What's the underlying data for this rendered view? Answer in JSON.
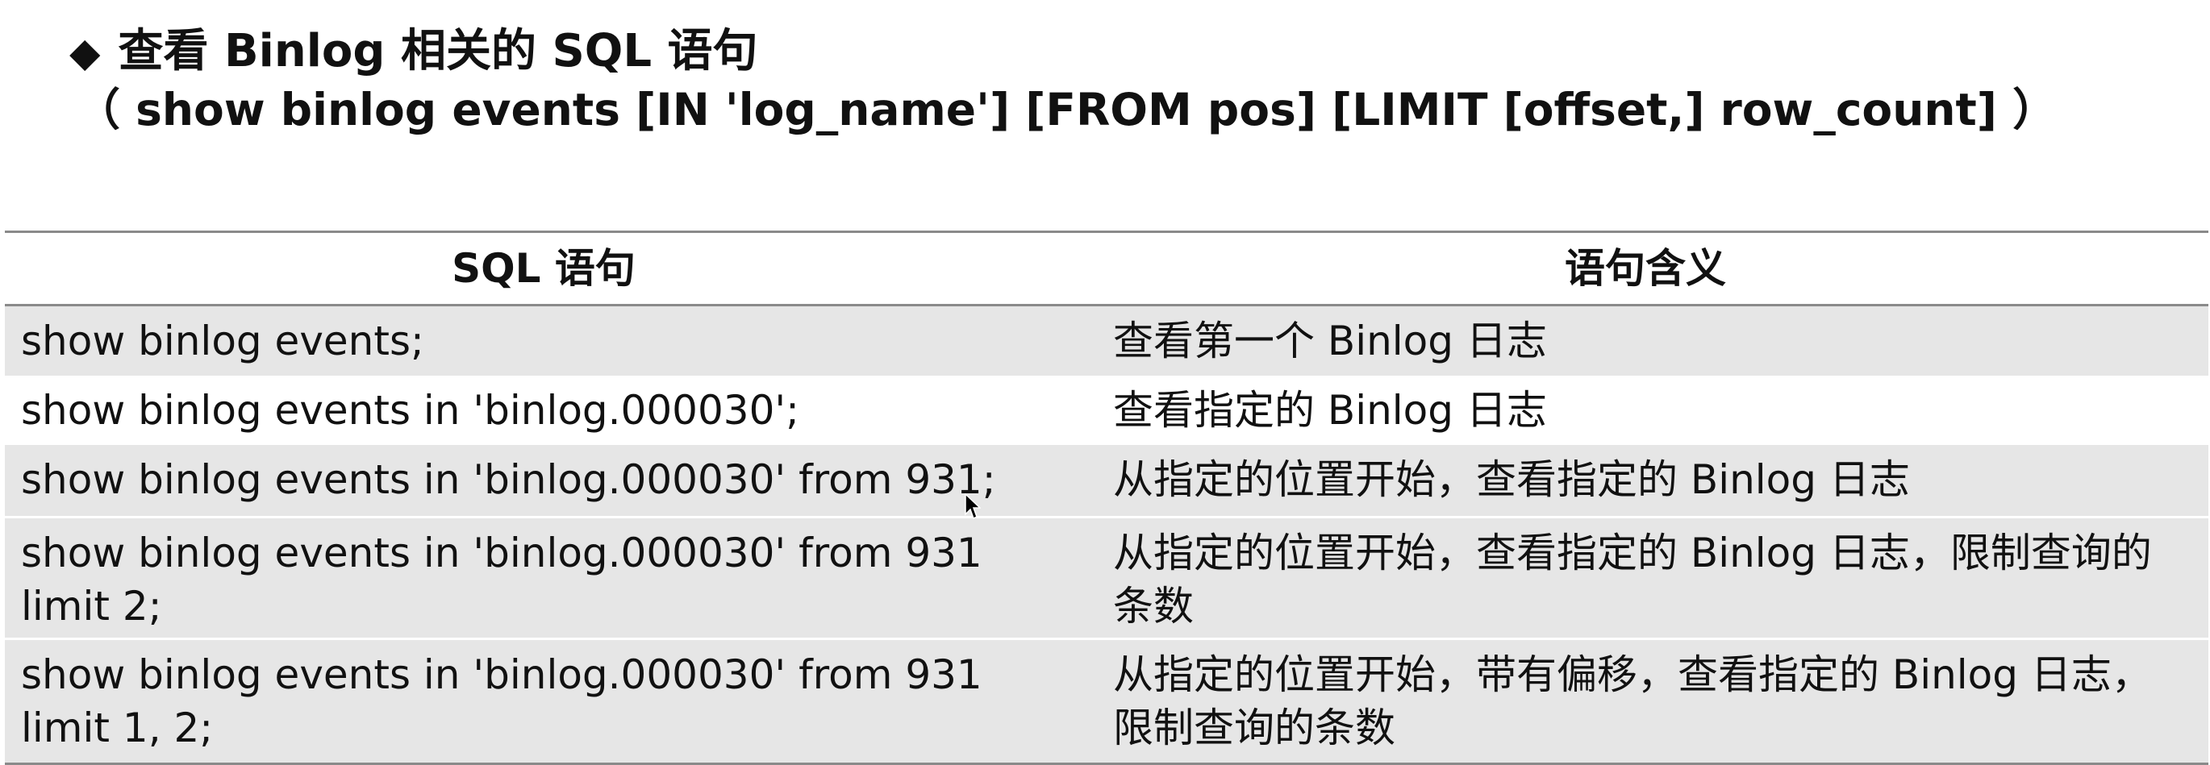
{
  "heading": {
    "bullet": "◆",
    "title": "查看 Binlog 相关的 SQL 语句",
    "syntax": "（  show binlog events [IN 'log_name'] [FROM pos] [LIMIT [offset,] row_count] ）"
  },
  "table": {
    "headers": [
      "SQL 语句",
      "语句含义"
    ],
    "rows": [
      {
        "sql": "show binlog events;",
        "meaning": "查看第一个 Binlog 日志"
      },
      {
        "sql": "show binlog events in 'binlog.000030';",
        "meaning": "查看指定的 Binlog 日志"
      },
      {
        "sql": "show binlog events in 'binlog.000030' from 931;",
        "meaning": "从指定的位置开始，查看指定的 Binlog 日志"
      },
      {
        "sql": "show binlog events in 'binlog.000030' from 931 limit 2;",
        "meaning": "从指定的位置开始，查看指定的 Binlog 日志，限制查询的条数"
      },
      {
        "sql": "show binlog events in 'binlog.000030' from 931 limit 1, 2;",
        "meaning": "从指定的位置开始，带有偏移，查看指定的 Binlog 日志，限制查询的条数"
      }
    ]
  },
  "colors": {
    "row_shade": "#e6e6e6",
    "rule": "#8a8a8a",
    "text": "#111111"
  }
}
